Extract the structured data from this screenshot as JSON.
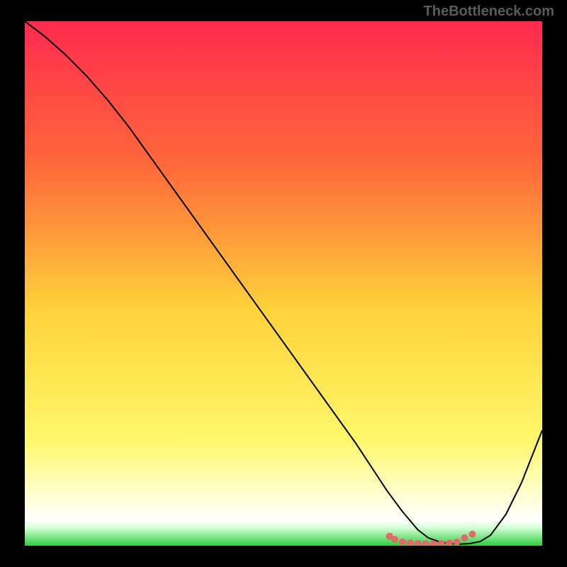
{
  "watermark": "TheBottleneck.com",
  "chart_data": {
    "type": "line",
    "title": "",
    "xlabel": "",
    "ylabel": "",
    "xlim": [
      0,
      100
    ],
    "ylim": [
      0,
      100
    ],
    "grid": false,
    "legend": false,
    "background_gradient": {
      "top": "#ff2a4f",
      "upper_mid": "#ff8a3a",
      "mid": "#ffd23a",
      "lower_mid": "#fff86a",
      "bottom_band": "#ffffff",
      "bottom": "#2ecc40"
    },
    "series": [
      {
        "name": "curve",
        "x": [
          0,
          4,
          8,
          12,
          16,
          20,
          24,
          28,
          32,
          36,
          40,
          44,
          48,
          52,
          56,
          60,
          64,
          67,
          70,
          73,
          76,
          78,
          80,
          82,
          84,
          86,
          88,
          90,
          93,
          96,
          100
        ],
        "y": [
          100,
          97,
          93.5,
          89.5,
          85,
          80,
          74.5,
          69,
          63.5,
          58,
          52.5,
          47,
          41.5,
          36,
          30.5,
          25,
          19.5,
          15,
          10.5,
          6.5,
          3,
          1.5,
          0.8,
          0.4,
          0.3,
          0.4,
          0.8,
          2,
          6,
          12,
          22
        ]
      }
    ],
    "points": {
      "name": "valley-dots",
      "x": [
        70.5,
        71.5,
        73,
        74.5,
        76,
        77.5,
        79,
        80.5,
        82,
        83.5,
        85,
        86.5
      ],
      "y": [
        1.8,
        1.2,
        0.7,
        0.5,
        0.4,
        0.35,
        0.35,
        0.4,
        0.5,
        0.7,
        1.5,
        2.2
      ]
    }
  }
}
